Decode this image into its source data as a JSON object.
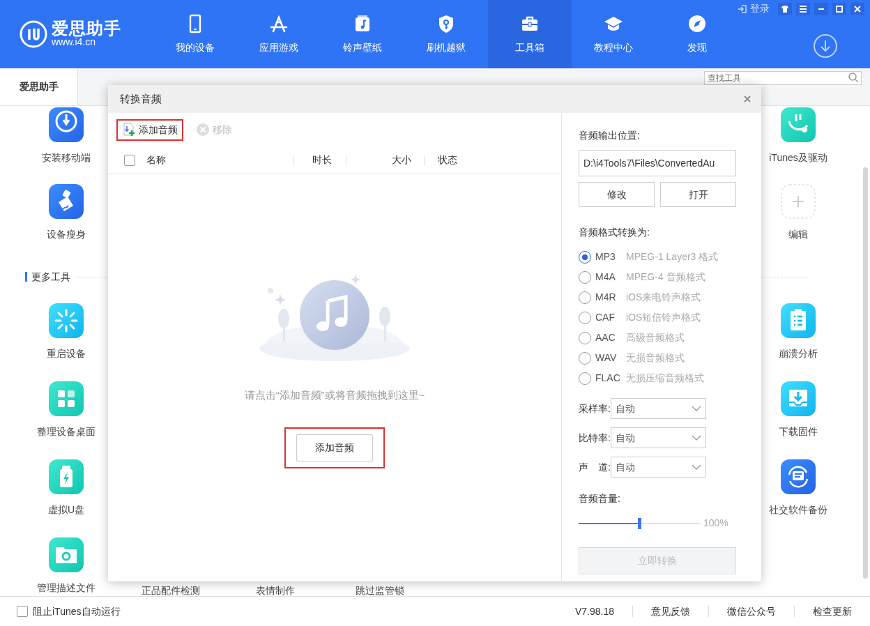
{
  "app": {
    "logo_title": "爱思助手",
    "logo_url": "www.i4.cn",
    "login": "登录"
  },
  "nav": [
    {
      "label": "我的设备",
      "kind": "phone",
      "selected": false
    },
    {
      "label": "应用游戏",
      "kind": "apps",
      "selected": false
    },
    {
      "label": "铃声壁纸",
      "kind": "music",
      "selected": false
    },
    {
      "label": "刷机越狱",
      "kind": "shield",
      "selected": false
    },
    {
      "label": "工具箱",
      "kind": "toolbox",
      "selected": true
    },
    {
      "label": "教程中心",
      "kind": "cap",
      "selected": false
    },
    {
      "label": "发现",
      "kind": "compass",
      "selected": false
    }
  ],
  "tabs": [
    {
      "label": "爱思助手",
      "selected": true
    }
  ],
  "search": {
    "placeholder": "查找工具"
  },
  "top_tools": [
    {
      "left": {
        "label": "安装移动端",
        "kind": "install"
      },
      "right": {
        "label": "iTunes及驱动",
        "kind": "itunes"
      }
    },
    {
      "left": {
        "label": "设备瘦身",
        "kind": "clean"
      },
      "right": {
        "label": "编辑",
        "kind": "add"
      }
    }
  ],
  "section_title": "更多工具",
  "more_tools": [
    {
      "left": {
        "label": "重启设备",
        "kind": "restart"
      },
      "right": {
        "label": "崩溃分析",
        "kind": "crash"
      }
    },
    {
      "left": {
        "label": "整理设备桌面",
        "kind": "desktop"
      },
      "right": {
        "label": "下载固件",
        "kind": "firmware"
      }
    },
    {
      "left": {
        "label": "虚拟U盘",
        "kind": "udisk"
      },
      "right": {
        "label": "社交软件备份",
        "kind": "social"
      }
    },
    {
      "left": {
        "label": "管理描述文件",
        "kind": "profile"
      },
      "middle": [
        "正品配件检测",
        "表情制作",
        "跳过监管锁"
      ]
    }
  ],
  "dialog": {
    "title": "转换音频",
    "toolbar": [
      {
        "label": "添加音频",
        "kind": "add",
        "disabled": false,
        "highlighted": true
      },
      {
        "label": "移除",
        "kind": "remove",
        "disabled": true,
        "highlighted": false
      }
    ],
    "table": {
      "select_all": false,
      "columns": [
        "名称",
        "时长",
        "大小",
        "状态"
      ]
    },
    "empty_message": "请点击“添加音频”或将音频拖拽到这里~",
    "empty_button": {
      "label": "添加音频",
      "highlighted": true
    },
    "output_label": "音频输出位置:",
    "output_path": "D:\\i4Tools7\\Files\\ConvertedAu",
    "path_buttons": [
      "修改",
      "打开"
    ],
    "format_label": "音频格式转换为:",
    "formats": [
      {
        "name": "MP3",
        "desc": "MPEG-1 Layer3 格式",
        "selected": true
      },
      {
        "name": "M4A",
        "desc": "MPEG-4 音频格式",
        "selected": false
      },
      {
        "name": "M4R",
        "desc": "iOS来电铃声格式",
        "selected": false
      },
      {
        "name": "CAF",
        "desc": "iOS短信铃声格式",
        "selected": false
      },
      {
        "name": "AAC",
        "desc": "高级音频格式",
        "selected": false
      },
      {
        "name": "WAV",
        "desc": "无损音频格式",
        "selected": false
      },
      {
        "name": "FLAC",
        "desc": "无损压缩音频格式",
        "selected": false
      }
    ],
    "selects": [
      {
        "label": "采样率:",
        "value": "自动"
      },
      {
        "label": "比特率:",
        "value": "自动"
      },
      {
        "label": "声　道:",
        "value": "自动"
      }
    ],
    "volume_label": "音频音量:",
    "volume": {
      "level": 0.5,
      "reading": "100%"
    },
    "convert_button": {
      "label": "立即转换",
      "disabled": true
    }
  },
  "status_bar": {
    "block_itunes": {
      "label": "阻止iTunes自动运行",
      "checked": false
    },
    "version": "V7.98.18",
    "links": [
      "意见反馈",
      "微信公众号",
      "检查更新"
    ]
  }
}
